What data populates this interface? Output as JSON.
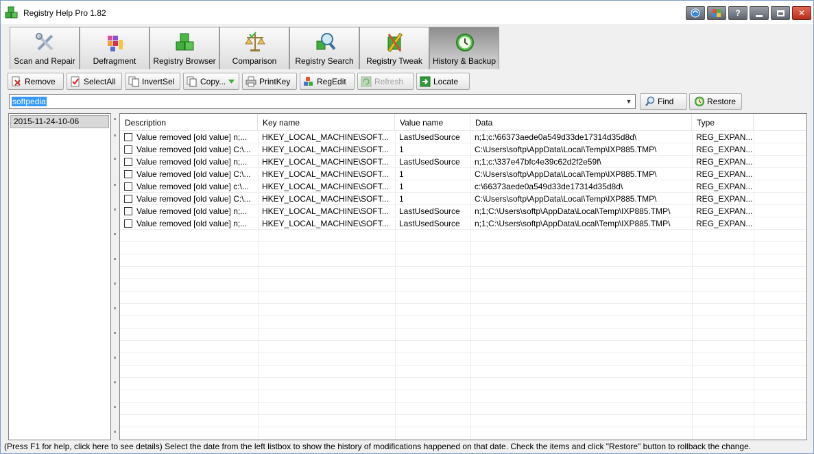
{
  "window": {
    "title": "Registry Help Pro 1.82"
  },
  "titlebar_buttons": [
    {
      "name": "update-button",
      "icon": "refresh-globe-icon"
    },
    {
      "name": "skin-button",
      "icon": "palette-icon"
    },
    {
      "name": "help-button",
      "icon": "question-icon",
      "glyph": "?"
    },
    {
      "name": "minimize-button",
      "icon": "minimize-icon"
    },
    {
      "name": "maximize-button",
      "icon": "maximize-icon"
    },
    {
      "name": "close-button",
      "icon": "close-icon",
      "glyph": "✕"
    }
  ],
  "tabs": [
    {
      "label": "Scan and Repair",
      "icon": "tools-icon"
    },
    {
      "label": "Defragment",
      "icon": "defrag-blocks-icon"
    },
    {
      "label": "Registry Browser",
      "icon": "cubes-icon"
    },
    {
      "label": "Comparison",
      "icon": "scale-icon"
    },
    {
      "label": "Registry Search",
      "icon": "magnifier-cube-icon"
    },
    {
      "label": "Registry Tweak",
      "icon": "wrench-cube-icon"
    },
    {
      "label": "History & Backup",
      "icon": "clock-icon",
      "active": true
    }
  ],
  "toolbar": {
    "remove": "Remove",
    "select_all": "SelectAll",
    "invert_sel": "InvertSel",
    "copy": "Copy...",
    "print_key": "PrintKey",
    "reg_edit": "RegEdit",
    "refresh": "Refresh",
    "locate": "Locate"
  },
  "search": {
    "value": "softpedia",
    "find_label": "Find",
    "restore_label": "Restore"
  },
  "history_dates": [
    "2015-11-24-10-06"
  ],
  "grid": {
    "columns": [
      "Description",
      "Key name",
      "Value name",
      "Data",
      "Type"
    ],
    "rows": [
      {
        "description": "Value removed [old value] n;...",
        "key": "HKEY_LOCAL_MACHINE\\SOFT...",
        "value_name": "LastUsedSource",
        "data": "n;1;c:\\66373aede0a549d33de17314d35d8d\\",
        "type": "REG_EXPAN..."
      },
      {
        "description": "Value removed [old value] C:\\...",
        "key": "HKEY_LOCAL_MACHINE\\SOFT...",
        "value_name": "1",
        "data": "C:\\Users\\softp\\AppData\\Local\\Temp\\IXP885.TMP\\",
        "type": "REG_EXPAN..."
      },
      {
        "description": "Value removed [old value] n;...",
        "key": "HKEY_LOCAL_MACHINE\\SOFT...",
        "value_name": "LastUsedSource",
        "data": "n;1;c:\\337e47bfc4e39c62d2f2e59f\\",
        "type": "REG_EXPAN..."
      },
      {
        "description": "Value removed [old value] C:\\...",
        "key": "HKEY_LOCAL_MACHINE\\SOFT...",
        "value_name": "1",
        "data": "C:\\Users\\softp\\AppData\\Local\\Temp\\IXP885.TMP\\",
        "type": "REG_EXPAN..."
      },
      {
        "description": "Value removed [old value] c:\\...",
        "key": "HKEY_LOCAL_MACHINE\\SOFT...",
        "value_name": "1",
        "data": "c:\\66373aede0a549d33de17314d35d8d\\",
        "type": "REG_EXPAN..."
      },
      {
        "description": "Value removed [old value] C:\\...",
        "key": "HKEY_LOCAL_MACHINE\\SOFT...",
        "value_name": "1",
        "data": "C:\\Users\\softp\\AppData\\Local\\Temp\\IXP885.TMP\\",
        "type": "REG_EXPAN..."
      },
      {
        "description": "Value removed [old value] n;...",
        "key": "HKEY_LOCAL_MACHINE\\SOFT...",
        "value_name": "LastUsedSource",
        "data": "n;1;C:\\Users\\softp\\AppData\\Local\\Temp\\IXP885.TMP\\",
        "type": "REG_EXPAN..."
      },
      {
        "description": "Value removed [old value] n;...",
        "key": "HKEY_LOCAL_MACHINE\\SOFT...",
        "value_name": "LastUsedSource",
        "data": "n;1;C:\\Users\\softp\\AppData\\Local\\Temp\\IXP885.TMP\\",
        "type": "REG_EXPAN..."
      }
    ]
  },
  "status_text": "(Press F1 for help, click here to see details) Select the date from the left listbox to show the history of modifications happened on that date. Check the items and click \"Restore\" button to rollback the change.",
  "colors": {
    "selection": "#3399ff",
    "window_bg": "#f0f0f0",
    "close_red": "#c93a25"
  }
}
